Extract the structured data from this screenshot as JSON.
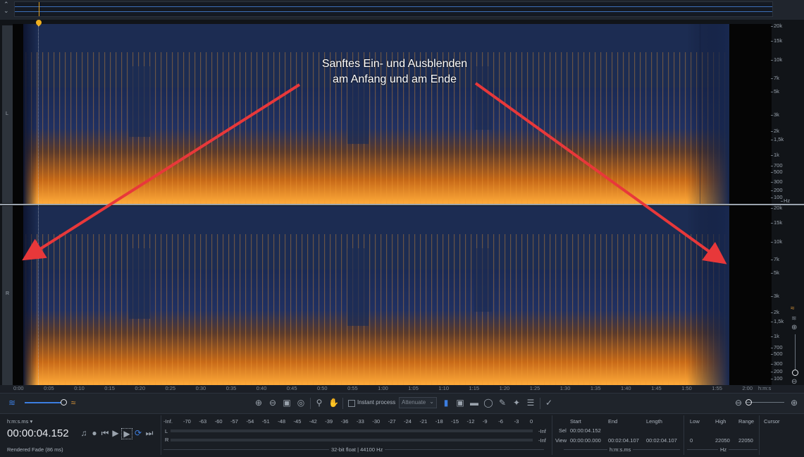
{
  "overview": {},
  "channels": {
    "left_label": "L",
    "right_label": "R"
  },
  "freq_labels_top": [
    "20k",
    "15k",
    "10k",
    "7k",
    "5k",
    "3k",
    "2k",
    "1,5k",
    "1k",
    "700",
    "500",
    "300",
    "200",
    "100",
    "Hz"
  ],
  "freq_labels_bottom": [
    "20k",
    "15k",
    "10k",
    "7k",
    "5k",
    "3k",
    "2k",
    "1,5k",
    "1k",
    "700",
    "500",
    "300",
    "200",
    "100"
  ],
  "time_ticks": [
    "0:00",
    "0:05",
    "0:10",
    "0:15",
    "0:20",
    "0:25",
    "0:30",
    "0:35",
    "0:40",
    "0:45",
    "0:50",
    "0:55",
    "1:00",
    "1:05",
    "1:10",
    "1:15",
    "1:20",
    "1:25",
    "1:30",
    "1:35",
    "1:40",
    "1:45",
    "1:50",
    "1:55",
    "2:00"
  ],
  "time_unit": "h:m:s",
  "annotation": {
    "line1": "Sanftes Ein- und Ausblenden",
    "line2": "am Anfang und am Ende"
  },
  "toolbar": {
    "instant_process_label": "Instant process",
    "mode_value": "Attenuate"
  },
  "transport": {
    "time_format": "h:m:s.ms",
    "time": "00:00:04.152",
    "status": "Rendered Fade (86 ms)"
  },
  "meter": {
    "scale": [
      "-Inf.",
      "-70",
      "-63",
      "-60",
      "-57",
      "-54",
      "-51",
      "-48",
      "-45",
      "-42",
      "-39",
      "-36",
      "-33",
      "-30",
      "-27",
      "-24",
      "-21",
      "-18",
      "-15",
      "-12",
      "-9",
      "-6",
      "-3",
      "0"
    ],
    "left_label": "L",
    "right_label": "R",
    "left_peak": "-Inf",
    "right_peak": "-Inf",
    "format": "32-bit float | 44100 Hz"
  },
  "selection": {
    "headers": [
      "Start",
      "End",
      "Length"
    ],
    "sel_label": "Sel",
    "sel_start": "00:00:04.152",
    "view_label": "View",
    "view_start": "00:00:00.000",
    "view_end": "00:02:04.107",
    "view_length": "00:02:04.107",
    "unit": "h:m:s.ms"
  },
  "frequency": {
    "headers": [
      "Low",
      "High",
      "Range"
    ],
    "low": "0",
    "high": "22050",
    "range": "22050",
    "unit": "Hz"
  },
  "cursor": {
    "header": "Cursor"
  },
  "colors": {
    "accent": "#3c7ee0",
    "arrow": "#e8383a",
    "spectrum_hot": "#ff9a2e",
    "spectrum_bg": "#1c2c52"
  }
}
